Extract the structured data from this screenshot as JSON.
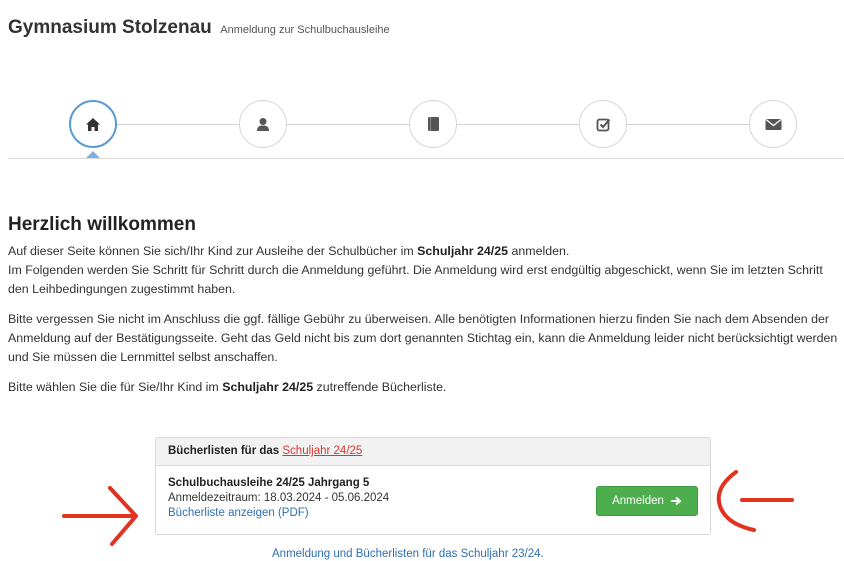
{
  "header": {
    "title": "Gymnasium Stolzenau",
    "subtitle": "Anmeldung zur Schulbuchausleihe"
  },
  "stepper": {
    "steps": [
      {
        "icon": "home-icon",
        "active": true
      },
      {
        "icon": "user-icon",
        "active": false
      },
      {
        "icon": "book-icon",
        "active": false
      },
      {
        "icon": "check-square-icon",
        "active": false
      },
      {
        "icon": "envelope-icon",
        "active": false
      }
    ],
    "active_color": "#5b9bd5"
  },
  "welcome": {
    "heading": "Herzlich willkommen",
    "p1_part1": "Auf dieser Seite können Sie sich/Ihr Kind zur Ausleihe der Schulbücher im ",
    "p1_bold": "Schuljahr 24/25",
    "p1_part2": " anmelden.",
    "p1_line2": "Im Folgenden werden Sie Schritt für Schritt durch die Anmeldung geführt. Die Anmeldung wird erst endgültig abgeschickt, wenn Sie im letzten Schritt den Leihbedingungen zugestimmt haben.",
    "p2": "Bitte vergessen Sie nicht im Anschluss die ggf. fällige Gebühr zu überweisen. Alle benötigten Informationen hierzu finden Sie nach dem Absenden der Anmeldung auf der Bestätigungsseite. Geht das Geld nicht bis zum dort genannten Stichtag ein, kann die Anmeldung leider nicht berücksichtigt werden und Sie müssen die Lernmittel selbst anschaffen.",
    "p3_part1": "Bitte wählen Sie die für Sie/Ihr Kind im ",
    "p3_bold": "Schuljahr 24/25",
    "p3_part2": " zutreffende Bücherliste."
  },
  "panel": {
    "heading_prefix": "Bücherlisten für das ",
    "heading_link": "Schuljahr 24/25",
    "list_title": "Schulbuchausleihe 24/25 Jahrgang 5",
    "list_period": "Anmeldezeitraum: 18.03.2024 - 05.06.2024",
    "list_link": "Bücherliste anzeigen (PDF)",
    "button_label": "Anmelden"
  },
  "footer": {
    "link": "Anmeldung und Bücherlisten für das Schuljahr 23/24."
  },
  "colors": {
    "button_green": "#4cae4c",
    "link_blue": "#2f6fb1",
    "link_red": "#d43a2f",
    "annotation_red": "#e0321e"
  }
}
